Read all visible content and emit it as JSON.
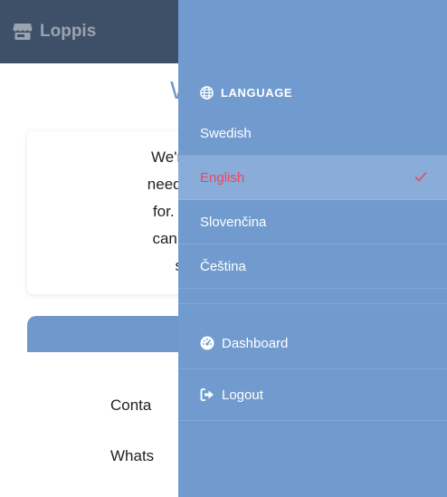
{
  "app": {
    "brand": "Loppis",
    "brand_icon": "store-icon"
  },
  "main": {
    "title_partial": "W",
    "intro_lines": [
      "We're clearing o",
      "need – and it mig",
      "for. From useful",
      "can bring a little",
      "somethin"
    ],
    "contact_lines": [
      "Conta",
      "Whats"
    ]
  },
  "drawer": {
    "section_title": "LANGUAGE",
    "section_icon": "globe-icon",
    "languages": [
      {
        "label": "Swedish",
        "selected": false
      },
      {
        "label": "English",
        "selected": true
      },
      {
        "label": "Slovenčina",
        "selected": false
      },
      {
        "label": "Čeština",
        "selected": false
      }
    ],
    "nav": [
      {
        "label": "Dashboard",
        "icon": "dashboard-gauge-icon"
      },
      {
        "label": "Logout",
        "icon": "logout-icon"
      }
    ]
  },
  "colors": {
    "topbar": "#3d5068",
    "drawer": "#719bcf",
    "active_item_bg": "#89acd9",
    "active_item_text": "#f0455e",
    "accent": "#7397c9"
  }
}
